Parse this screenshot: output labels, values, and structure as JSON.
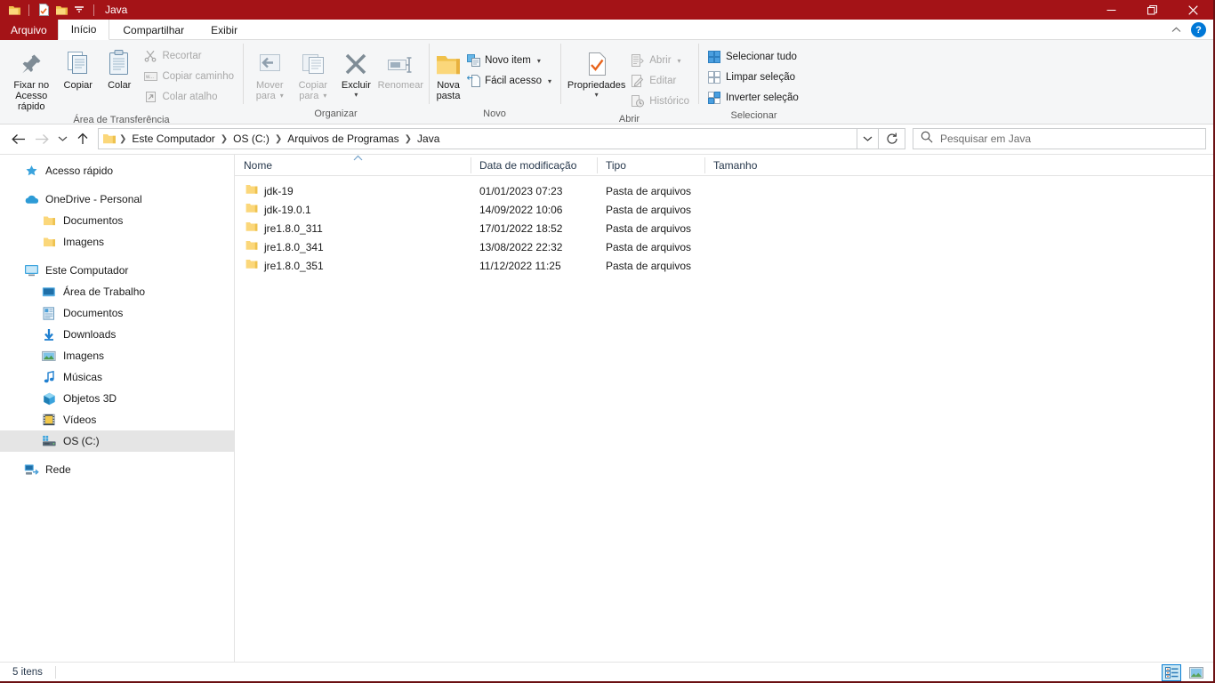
{
  "window": {
    "title": "Java",
    "accent_color": "#a41317",
    "quick_access": [
      {
        "name": "folder-icon",
        "label": "Folder"
      },
      {
        "name": "properties-icon",
        "label": "Propriedades"
      },
      {
        "name": "folder-icon",
        "label": "Nova pasta"
      },
      {
        "name": "chevron-down-icon",
        "label": "Personalizar Barra de Ferramentas de Acesso Rápido"
      }
    ],
    "controls": {
      "minimize": "Minimizar",
      "restore": "Restaurar",
      "close": "Fechar"
    }
  },
  "tabs": {
    "file_menu": "Arquivo",
    "items": [
      {
        "label": "Início",
        "active": true
      },
      {
        "label": "Compartilhar",
        "active": false
      },
      {
        "label": "Exibir",
        "active": false
      }
    ],
    "collapse_label": "Minimizar a Faixa de Opções",
    "help_label": "?"
  },
  "ribbon": {
    "groups": [
      {
        "title": "Área de Transferência",
        "big_buttons": [
          {
            "label_line1": "Fixar no",
            "label_line2": "Acesso rápido",
            "icon": "pin-icon",
            "disabled": false
          },
          {
            "label_line1": "Copiar",
            "label_line2": "",
            "icon": "copy-icon",
            "disabled": false
          },
          {
            "label_line1": "Colar",
            "label_line2": "",
            "icon": "paste-icon",
            "disabled": false
          }
        ],
        "small_buttons": [
          {
            "label": "Recortar",
            "icon": "scissors-icon",
            "disabled": true
          },
          {
            "label": "Copiar caminho",
            "icon": "copy-path-icon",
            "disabled": true
          },
          {
            "label": "Colar atalho",
            "icon": "paste-shortcut-icon",
            "disabled": true
          }
        ]
      },
      {
        "title": "Organizar",
        "big_buttons": [
          {
            "label_line1": "Mover",
            "label_line2": "para",
            "icon": "move-to-icon",
            "disabled": true,
            "dropdown": true
          },
          {
            "label_line1": "Copiar",
            "label_line2": "para",
            "icon": "copy-to-icon",
            "disabled": true,
            "dropdown": true
          },
          {
            "label_line1": "Excluir",
            "label_line2": "",
            "icon": "delete-x-icon",
            "disabled": false,
            "dropdown": true
          },
          {
            "label_line1": "Renomear",
            "label_line2": "",
            "icon": "rename-icon",
            "disabled": true
          }
        ],
        "small_buttons": []
      },
      {
        "title": "Novo",
        "big_buttons": [
          {
            "label_line1": "Nova",
            "label_line2": "pasta",
            "icon": "new-folder-icon",
            "disabled": false
          }
        ],
        "small_buttons": [
          {
            "label": "Novo item",
            "icon": "new-item-icon",
            "disabled": false,
            "dropdown": true
          },
          {
            "label": "Fácil acesso",
            "icon": "easy-access-icon",
            "disabled": false,
            "dropdown": true
          }
        ]
      },
      {
        "title": "Abrir",
        "big_buttons": [
          {
            "label_line1": "Propriedades",
            "label_line2": "",
            "icon": "properties-icon",
            "disabled": false,
            "dropdown": true
          }
        ],
        "small_buttons": [
          {
            "label": "Abrir",
            "icon": "open-icon",
            "disabled": true,
            "dropdown": true
          },
          {
            "label": "Editar",
            "icon": "edit-icon",
            "disabled": true
          },
          {
            "label": "Histórico",
            "icon": "history-icon",
            "disabled": true
          }
        ]
      },
      {
        "title": "Selecionar",
        "big_buttons": [],
        "small_buttons": [
          {
            "label": "Selecionar tudo",
            "icon": "select-all-icon",
            "disabled": false
          },
          {
            "label": "Limpar seleção",
            "icon": "clear-selection-icon",
            "disabled": false
          },
          {
            "label": "Inverter seleção",
            "icon": "invert-selection-icon",
            "disabled": false
          }
        ]
      }
    ]
  },
  "address_bar": {
    "back_label": "Voltar",
    "forward_label": "Avançar",
    "recent_label": "Locais recentes",
    "up_label": "Acima",
    "breadcrumbs": [
      "Este Computador",
      "OS (C:)",
      "Arquivos de Programas",
      "Java"
    ],
    "dropdown_label": "Histórico de locais anteriores",
    "refresh_label": "Atualizar",
    "search_placeholder": "Pesquisar em Java"
  },
  "sidebar": {
    "items": [
      {
        "label": "Acesso rápido",
        "icon": "star-pin-icon",
        "level": 0,
        "selected": false
      },
      {
        "label": "OneDrive - Personal",
        "icon": "cloud-icon",
        "level": 0,
        "selected": false,
        "gap_before": true
      },
      {
        "label": "Documentos",
        "icon": "folder-icon",
        "level": 1,
        "selected": false
      },
      {
        "label": "Imagens",
        "icon": "folder-icon",
        "level": 1,
        "selected": false
      },
      {
        "label": "Este Computador",
        "icon": "computer-icon",
        "level": 0,
        "selected": false,
        "gap_before": true
      },
      {
        "label": "Área de Trabalho",
        "icon": "desktop-icon",
        "level": 1,
        "selected": false
      },
      {
        "label": "Documentos",
        "icon": "documents-icon",
        "level": 1,
        "selected": false
      },
      {
        "label": "Downloads",
        "icon": "downloads-icon",
        "level": 1,
        "selected": false
      },
      {
        "label": "Imagens",
        "icon": "pictures-icon",
        "level": 1,
        "selected": false
      },
      {
        "label": "Músicas",
        "icon": "music-icon",
        "level": 1,
        "selected": false
      },
      {
        "label": "Objetos 3D",
        "icon": "objects3d-icon",
        "level": 1,
        "selected": false
      },
      {
        "label": "Vídeos",
        "icon": "videos-icon",
        "level": 1,
        "selected": false
      },
      {
        "label": "OS (C:)",
        "icon": "drive-icon",
        "level": 1,
        "selected": true
      },
      {
        "label": "Rede",
        "icon": "network-icon",
        "level": 0,
        "selected": false,
        "gap_before": true
      }
    ]
  },
  "file_list": {
    "columns": [
      {
        "label": "Nome",
        "sorted": true,
        "sort_dir": "asc"
      },
      {
        "label": "Data de modificação",
        "sorted": false
      },
      {
        "label": "Tipo",
        "sorted": false
      },
      {
        "label": "Tamanho",
        "sorted": false
      }
    ],
    "rows": [
      {
        "name": "jdk-19",
        "date": "01/01/2023 07:23",
        "type": "Pasta de arquivos",
        "size": "",
        "icon": "folder-icon"
      },
      {
        "name": "jdk-19.0.1",
        "date": "14/09/2022 10:06",
        "type": "Pasta de arquivos",
        "size": "",
        "icon": "folder-icon"
      },
      {
        "name": "jre1.8.0_311",
        "date": "17/01/2022 18:52",
        "type": "Pasta de arquivos",
        "size": "",
        "icon": "folder-icon"
      },
      {
        "name": "jre1.8.0_341",
        "date": "13/08/2022 22:32",
        "type": "Pasta de arquivos",
        "size": "",
        "icon": "folder-icon"
      },
      {
        "name": "jre1.8.0_351",
        "date": "11/12/2022 11:25",
        "type": "Pasta de arquivos",
        "size": "",
        "icon": "folder-icon"
      }
    ]
  },
  "status_bar": {
    "item_count": "5 itens",
    "views": [
      {
        "name": "details-view",
        "label": "Detalhes",
        "active": true
      },
      {
        "name": "large-icons-view",
        "label": "Ícones grandes",
        "active": false
      }
    ]
  }
}
